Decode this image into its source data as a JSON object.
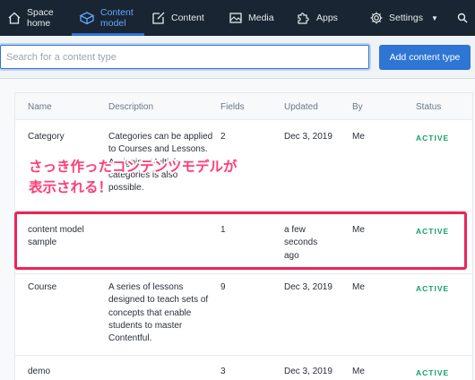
{
  "nav": {
    "items": [
      {
        "label": "Space\nhome",
        "icon": "house-icon"
      },
      {
        "label": "Content\nmodel",
        "icon": "cube-icon",
        "active": true
      },
      {
        "label": "Content",
        "icon": "edit-icon"
      },
      {
        "label": "Media",
        "icon": "image-icon"
      },
      {
        "label": "Apps",
        "icon": "puzzle-icon"
      },
      {
        "label": "Settings",
        "icon": "gear-icon"
      }
    ],
    "search_icon": "search-icon"
  },
  "toolbar": {
    "search_placeholder": "Search for a content type",
    "add_label": "Add content type"
  },
  "table": {
    "columns": [
      "Name",
      "Description",
      "Fields",
      "Updated",
      "By",
      "Status"
    ],
    "rows": [
      {
        "name": "Category",
        "description": "Categories can be applied to Courses and Lessons. Assigning Multiple categories is also possible.",
        "fields": "2",
        "updated": "Dec 3, 2019",
        "by": "Me",
        "status": "ACTIVE"
      },
      {
        "name": "content model sample",
        "description": "",
        "fields": "1",
        "updated": "a few seconds ago",
        "by": "Me",
        "status": "ACTIVE"
      },
      {
        "name": "Course",
        "description": "A series of lessons designed to teach sets of concepts that enable students to master Contentful.",
        "fields": "9",
        "updated": "Dec 3, 2019",
        "by": "Me",
        "status": "ACTIVE"
      },
      {
        "name": "demo",
        "description": "",
        "fields": "3",
        "updated": "Dec 3, 2019",
        "by": "Me",
        "status": "ACTIVE"
      }
    ]
  },
  "annotation": {
    "line1": "さっき作ったコンテンツモデルが",
    "line2": "表示される！",
    "color": "#ff3d77",
    "box_color": "#ec2458"
  },
  "colors": {
    "nav_bg": "#192532",
    "accent": "#2e75d4",
    "status_active": "#14a06a"
  }
}
